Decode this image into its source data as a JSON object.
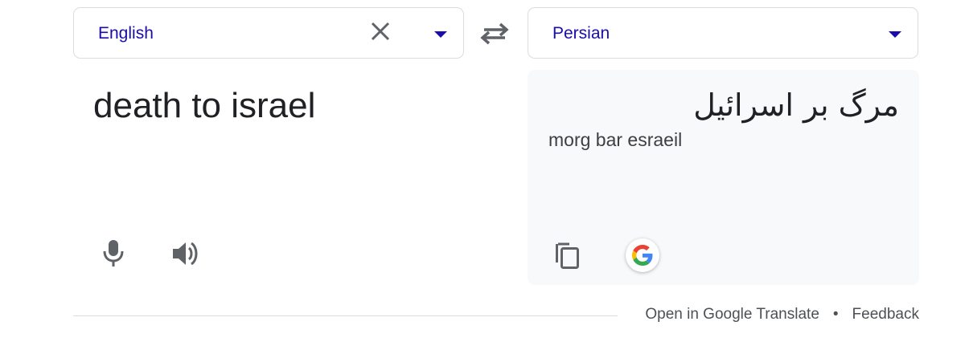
{
  "source_language": {
    "label": "English"
  },
  "target_language": {
    "label": "Persian"
  },
  "source": {
    "text": "death to israel"
  },
  "target": {
    "text": "مرگ بر اسرائیل",
    "transliteration": "morg bar esraeil"
  },
  "footer": {
    "open_link": "Open in Google Translate",
    "separator": "•",
    "feedback_link": "Feedback"
  },
  "colors": {
    "language_text": "#1a0dab",
    "icon_gray": "#5f6368",
    "target_panel_bg": "#f8f9fa"
  },
  "icons": [
    "swap-icon",
    "close-icon",
    "microphone-icon",
    "speaker-icon",
    "copy-icon",
    "google-logo-icon",
    "chevron-down-icon"
  ]
}
